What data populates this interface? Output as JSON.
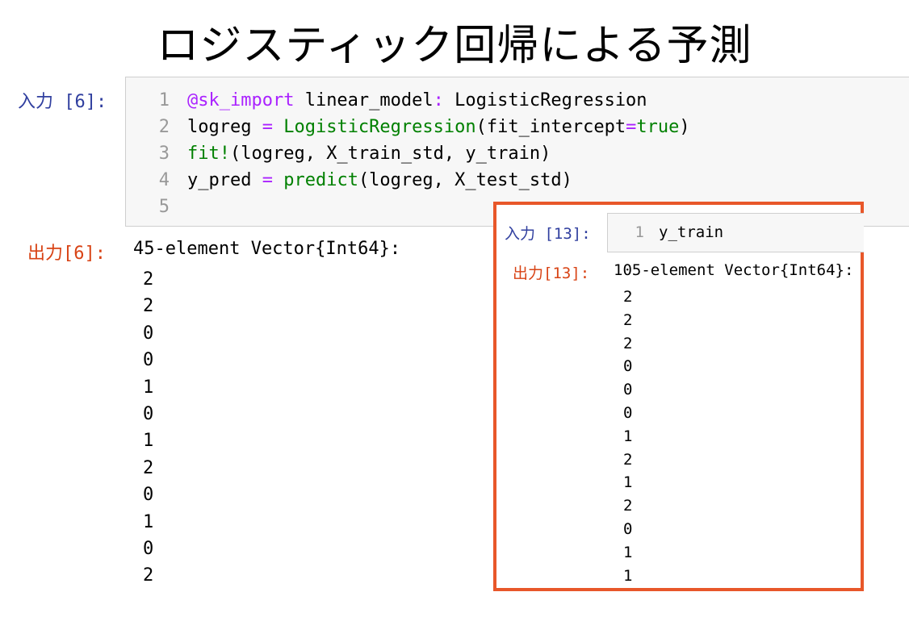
{
  "title": "ロジスティック回帰による予測",
  "cell6": {
    "in_prompt": "入力 [6]:",
    "line_numbers": [
      "1",
      "2",
      "3",
      "4",
      "5"
    ],
    "code": [
      [
        {
          "t": "@sk_import",
          "c": "kw-macro"
        },
        {
          "t": " linear_model",
          "c": ""
        },
        {
          "t": ":",
          "c": "kw-op"
        },
        {
          "t": " LogisticRegression",
          "c": ""
        }
      ],
      [
        {
          "t": "logreg ",
          "c": ""
        },
        {
          "t": "=",
          "c": "kw-op"
        },
        {
          "t": " ",
          "c": ""
        },
        {
          "t": "LogisticRegression",
          "c": "kw-fn"
        },
        {
          "t": "(fit_intercept",
          "c": ""
        },
        {
          "t": "=",
          "c": "kw-op"
        },
        {
          "t": "true",
          "c": "kw-fn"
        },
        {
          "t": ")",
          "c": ""
        }
      ],
      [
        {
          "t": "fit!",
          "c": "kw-fn"
        },
        {
          "t": "(logreg, X_train_std, y_train)",
          "c": ""
        }
      ],
      [
        {
          "t": "y_pred ",
          "c": ""
        },
        {
          "t": "=",
          "c": "kw-op"
        },
        {
          "t": " ",
          "c": ""
        },
        {
          "t": "predict",
          "c": "kw-fn"
        },
        {
          "t": "(logreg, X_test_std)",
          "c": ""
        }
      ],
      []
    ],
    "out_prompt": "出力[6]:",
    "output_header": "45-element Vector{Int64}:",
    "output_values": [
      "2",
      "2",
      "0",
      "0",
      "1",
      "0",
      "1",
      "2",
      "0",
      "1",
      "0",
      "2"
    ]
  },
  "cell13": {
    "in_prompt": "入力 [13]:",
    "line_number": "1",
    "code": "y_train",
    "out_prompt": "出力[13]:",
    "output_header": "105-element Vector{Int64}:",
    "output_values": [
      "2",
      "2",
      "2",
      "0",
      "0",
      "0",
      "1",
      "2",
      "1",
      "2",
      "0",
      "1",
      "1"
    ]
  },
  "colors": {
    "highlight_border": "#e8572a",
    "in_prompt": "#303f9f",
    "out_prompt": "#d84315",
    "keyword_function": "#008000",
    "keyword_macro": "#aa22ff"
  }
}
